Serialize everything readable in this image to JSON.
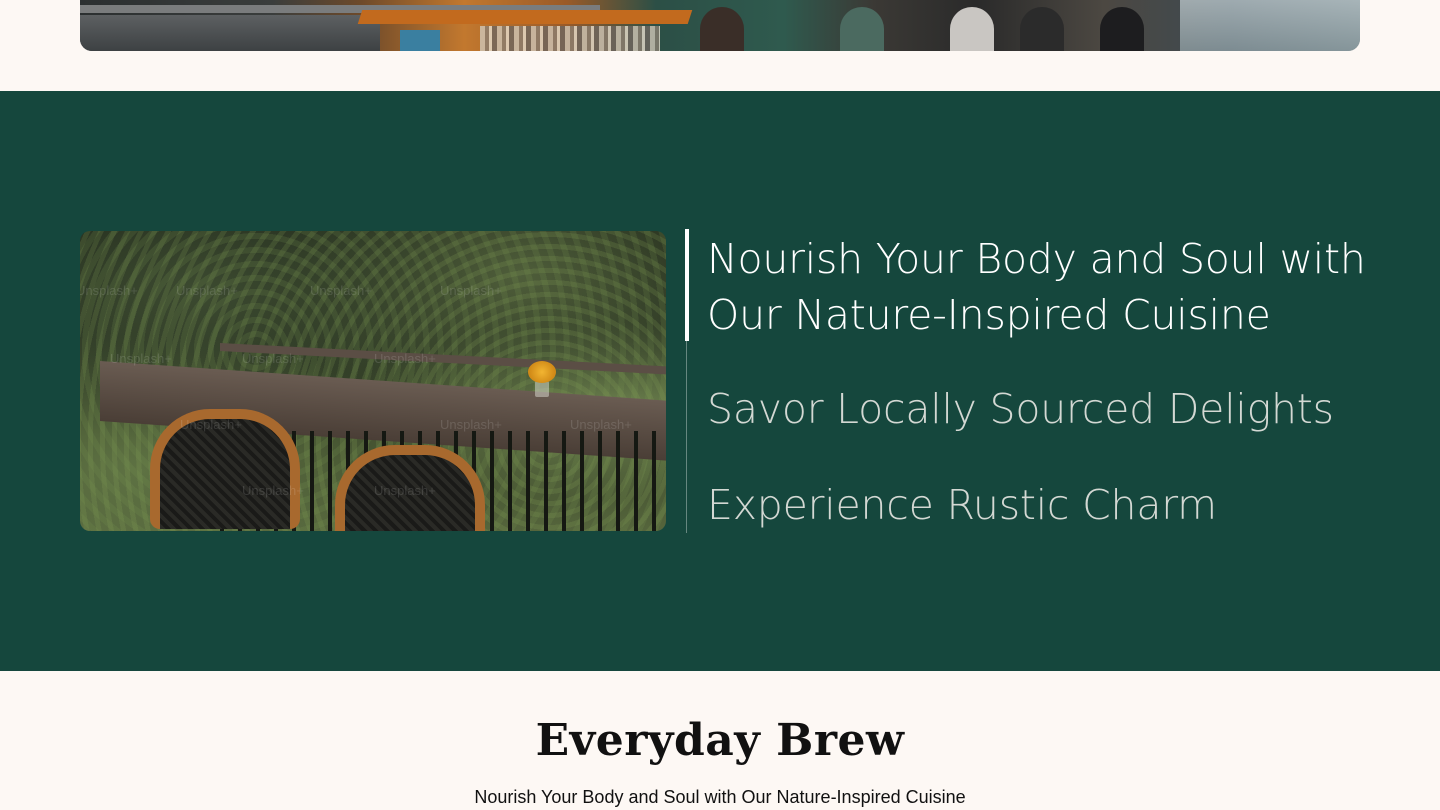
{
  "hero": {
    "image_alt": "restaurant interior with bar counter and diners"
  },
  "feature": {
    "image_alt": "wooden table with wicker chairs surrounded by plants",
    "watermark": "Unsplash+",
    "accordion": [
      {
        "label": "Nourish Your Body and Soul with Our Nature-Inspired Cuisine",
        "active": true
      },
      {
        "label": "Savor Locally Sourced Delights",
        "active": false
      },
      {
        "label": "Experience Rustic Charm",
        "active": false
      }
    ]
  },
  "brew": {
    "title": "Everyday Brew",
    "subtitle": "Nourish Your Body and Soul with Our Nature-Inspired Cuisine"
  },
  "colors": {
    "page_bg": "#fdf8f4",
    "section_green": "#15473d",
    "active_text": "#ffffff",
    "inactive_text": "#d3d8d3"
  }
}
